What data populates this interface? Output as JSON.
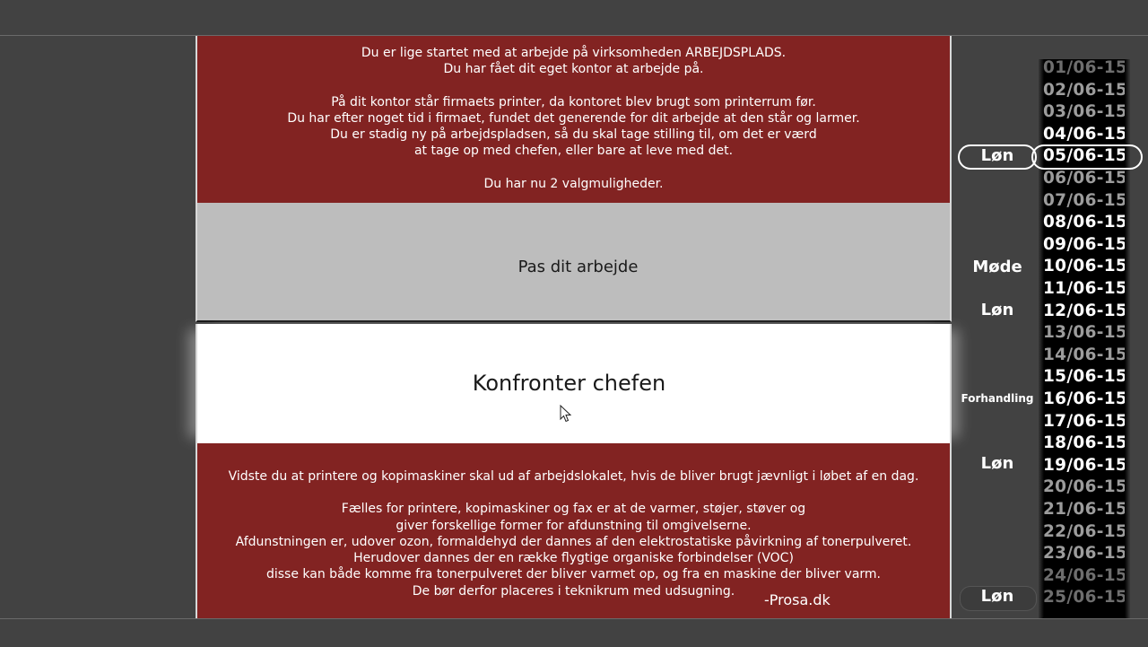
{
  "intro": {
    "p1_l1": "Du er lige startet med at arbejde på virksomheden ARBEJDSPLADS.",
    "p1_l2": "Du har fået dit eget kontor at arbejde på.",
    "p2_l1": "På dit kontor står firmaets printer, da kontoret blev brugt som printerrum før.",
    "p2_l2": "Du har efter noget tid i firmaet, fundet det generende for dit arbejde at den står og larmer.",
    "p2_l3": "Du er stadig ny på arbejdspladsen, så du skal tage stilling til, om det er værd",
    "p2_l4": "at tage op med chefen, eller bare at leve med det.",
    "p3_l1": "Du har nu 2 valgmuligheder."
  },
  "choices": {
    "choice1": "Pas dit arbejde",
    "choice2": "Konfronter chefen"
  },
  "facts": {
    "p1": "Vidste du at printere og kopimaskiner skal ud af arbejdslokalet, hvis de bliver brugt jævnligt i løbet af en dag.",
    "l1": "Fælles for printere, kopimaskiner og fax er at de varmer, støjer, støver og",
    "l2": "giver forskellige former for afdunstning til omgivelserne.",
    "l3": "Afdunstningen er, udover ozon, formaldehyd der dannes af den elektrostatiske påvirkning af tonerpulveret.",
    "l4": "Herudover dannes der en række flygtige organiske forbindelser (VOC)",
    "l5": "disse kan både komme fra tonerpulveret der bliver varmet op, og fra en maskine der bliver varm.",
    "l6": "De bør derfor placeres i teknikrum med udsugning.",
    "source": "-Prosa.dk"
  },
  "calendar": {
    "dates": [
      {
        "label": "01/06-15",
        "tone": "faint"
      },
      {
        "label": "02/06-15",
        "tone": "dim"
      },
      {
        "label": "03/06-15",
        "tone": "dim"
      },
      {
        "label": "04/06-15",
        "tone": "bright"
      },
      {
        "label": "05/06-15",
        "tone": "bright"
      },
      {
        "label": "06/06-15",
        "tone": "dim"
      },
      {
        "label": "07/06-15",
        "tone": "dim"
      },
      {
        "label": "08/06-15",
        "tone": "bright"
      },
      {
        "label": "09/06-15",
        "tone": "bright"
      },
      {
        "label": "10/06-15",
        "tone": "bright"
      },
      {
        "label": "11/06-15",
        "tone": "bright"
      },
      {
        "label": "12/06-15",
        "tone": "bright"
      },
      {
        "label": "13/06-15",
        "tone": "dim"
      },
      {
        "label": "14/06-15",
        "tone": "dim"
      },
      {
        "label": "15/06-15",
        "tone": "bright"
      },
      {
        "label": "16/06-15",
        "tone": "bright"
      },
      {
        "label": "17/06-15",
        "tone": "bright"
      },
      {
        "label": "18/06-15",
        "tone": "bright"
      },
      {
        "label": "19/06-15",
        "tone": "bright"
      },
      {
        "label": "20/06-15",
        "tone": "dim"
      },
      {
        "label": "21/06-15",
        "tone": "dim"
      },
      {
        "label": "22/06-15",
        "tone": "dim"
      },
      {
        "label": "23/06-15",
        "tone": "dim"
      },
      {
        "label": "24/06-15",
        "tone": "faint"
      },
      {
        "label": "25/06-15",
        "tone": "faint"
      }
    ],
    "current_date": "05/06-15",
    "events": [
      {
        "date": "05/06-15",
        "label": "Løn"
      },
      {
        "date": "10/06-15",
        "label": "Møde"
      },
      {
        "date": "12/06-15",
        "label": "Løn"
      },
      {
        "date": "16/06-15",
        "label": "Forhandling"
      },
      {
        "date": "19/06-15",
        "label": "Løn"
      },
      {
        "date": "25/06-15",
        "label": "Løn"
      }
    ]
  },
  "colors": {
    "panel_red": "#822322",
    "choice1_bg": "#bdbdbd",
    "choice2_bg": "#ffffff",
    "background": "#424242"
  }
}
